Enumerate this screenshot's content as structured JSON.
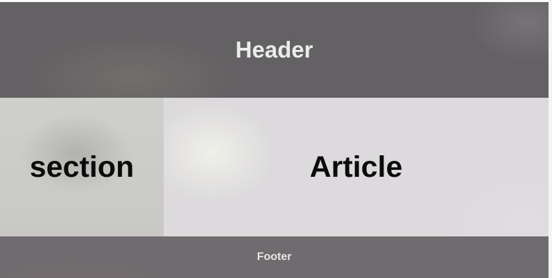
{
  "header": {
    "title": "Header"
  },
  "section": {
    "title": "section"
  },
  "article": {
    "title": "Article"
  },
  "footer": {
    "title": "Footer"
  },
  "colors": {
    "header_bg": "#636163",
    "section_bg": "#cfcfcc",
    "article_bg": "#dcdadc",
    "footer_bg": "#6f6b6e",
    "header_text": "#ececec",
    "body_text": "#0b0b0b"
  }
}
